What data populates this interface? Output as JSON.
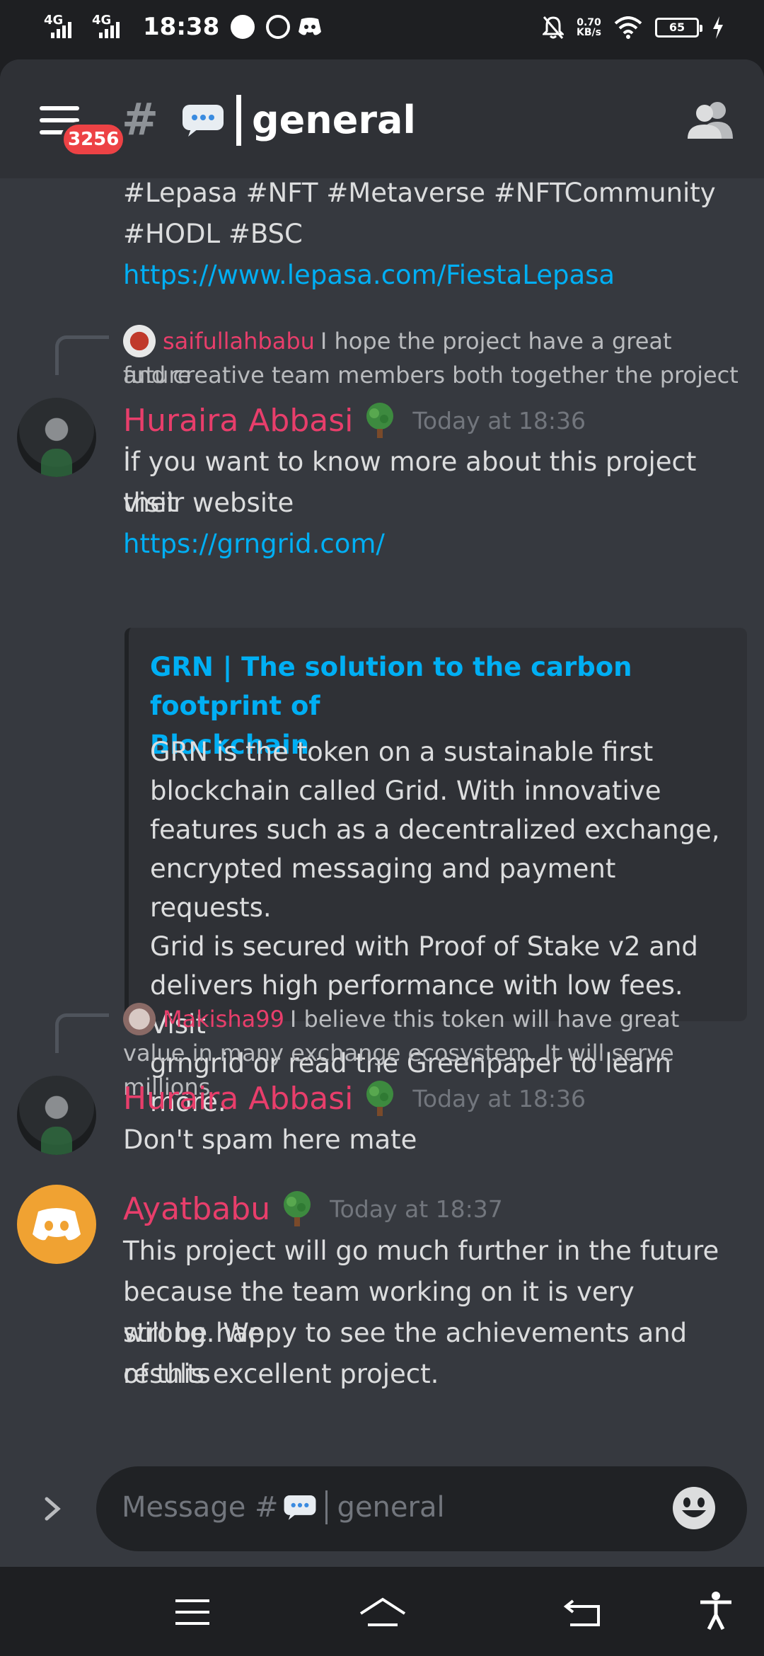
{
  "status_bar": {
    "network1": "4G",
    "network2": "4G",
    "time": "18:38",
    "speed_value": "0.70",
    "speed_unit": "KB/s",
    "battery": "65"
  },
  "header": {
    "badge": "3256",
    "channel_name": "general",
    "icon_names": [
      "menu-icon",
      "hash-icon",
      "speech-bubble-icon",
      "members-icon"
    ]
  },
  "messages": {
    "prev_tail": {
      "line1": "#Lepasa #NFT #Metaverse #NFTCommunity",
      "line2": "#HODL #BSC",
      "link": "https://www.lepasa.com/FiestaLepasa"
    },
    "msg1": {
      "reply_author": "saifullahbabu",
      "reply_line1": "I hope the project  have a great  future",
      "reply_line2": "and creative  team  members  both  together  the project",
      "author": "Huraira Abbasi",
      "timestamp": "Today at 18:36",
      "line1": "İf you want to know more about this project visit",
      "line2": "their website",
      "link": "https://grngrid.com/",
      "embed_title1": "GRN | The solution to the carbon footprint of",
      "embed_title2": "Blockchain",
      "embed_lines": [
        "GRN is the token on a sustainable first",
        "blockchain called Grid. With innovative",
        "features such as a decentralized exchange,",
        "encrypted messaging and payment requests.",
        "Grid is secured with Proof of Stake v2 and",
        "delivers high performance with low fees. Visit",
        "grngrid or read the Greenpaper to learn more."
      ]
    },
    "msg2": {
      "reply_author": "Makisha99",
      "reply_line1": "I believe  this token will have great",
      "reply_line2": "value in many exchange ecosystem. It will serve millions",
      "author": "Huraira Abbasi",
      "timestamp": "Today at 18:36",
      "text": "Don't spam here mate"
    },
    "msg3": {
      "author": "Ayatbabu",
      "timestamp": "Today at 18:37",
      "lines": [
        "This project will go much further in the future",
        "because the team working on it is very strong. We",
        "will be happy to see the achievements and results",
        "of this excellent project."
      ]
    }
  },
  "composer": {
    "placeholder_prefix": "Message #",
    "placeholder_channel": "general"
  },
  "colors": {
    "accent_link": "#00aff4",
    "username": "#e83e6b",
    "badge": "#ed4245",
    "background": "#36393f"
  }
}
